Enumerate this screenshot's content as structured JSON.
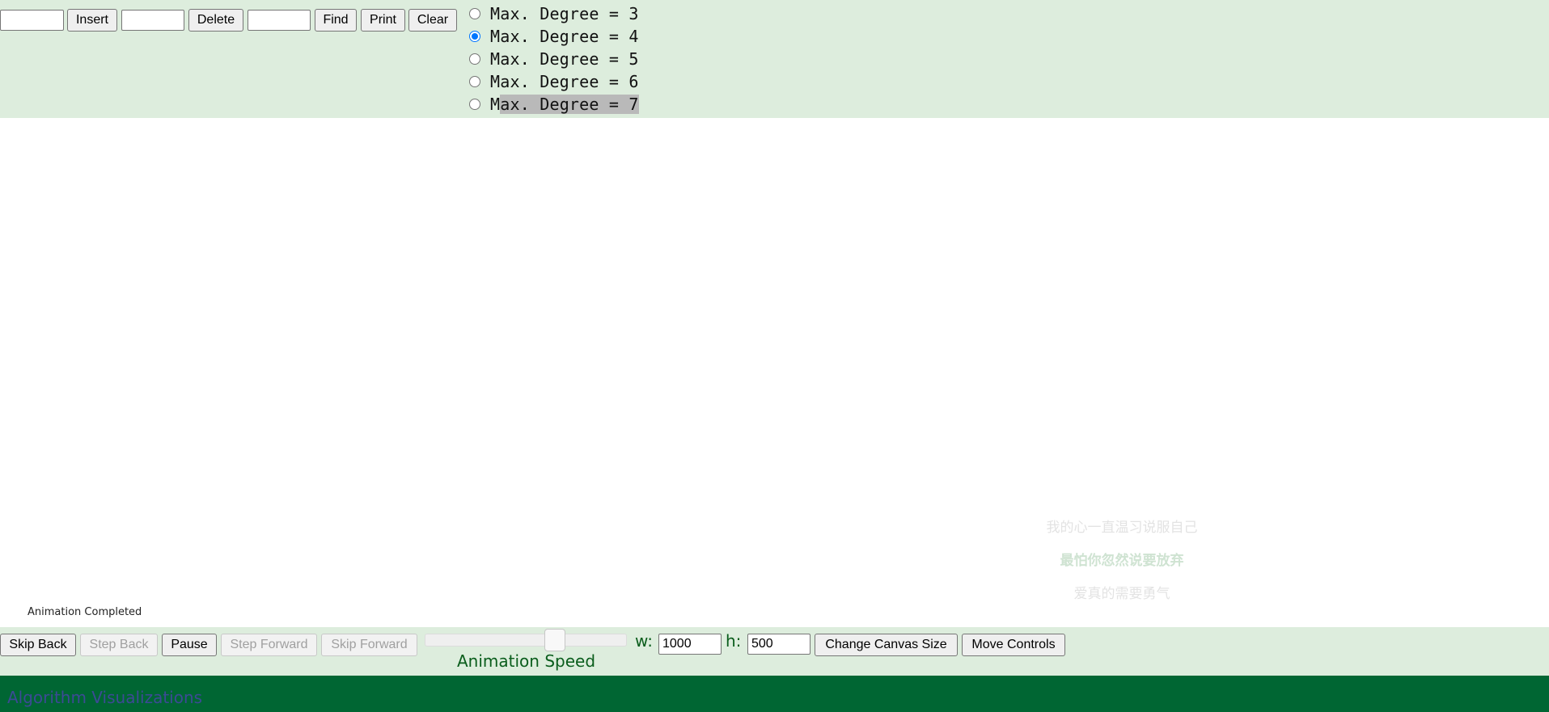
{
  "toolbar": {
    "insert_input_value": "",
    "insert_label": "Insert",
    "delete_input_value": "",
    "delete_label": "Delete",
    "find_input_value": "",
    "find_label": "Find",
    "print_label": "Print",
    "clear_label": "Clear"
  },
  "degree_options": [
    {
      "label": "Max. Degree = 3",
      "checked": false
    },
    {
      "label": "Max. Degree = 4",
      "checked": true
    },
    {
      "label": "Max. Degree = 5",
      "checked": false
    },
    {
      "label": "Max. Degree = 6",
      "checked": false
    },
    {
      "label_prefix": "M",
      "label_highlighted": "ax. Degree = 7",
      "checked": false
    }
  ],
  "canvas": {
    "status_text": "Animation Completed",
    "watermark_lines": [
      "我的心一直温习说服自己",
      "最怕你忽然说要放弃",
      "爱真的需要勇气"
    ]
  },
  "controls": {
    "skip_back": "Skip Back",
    "step_back": "Step Back",
    "pause": "Pause",
    "step_forward": "Step Forward",
    "skip_forward": "Skip Forward",
    "speed_label": "Animation Speed",
    "speed_fraction": 0.6,
    "width_label": "w:",
    "width_value": "1000",
    "height_label": "h:",
    "height_value": "500",
    "change_canvas_size": "Change Canvas Size",
    "move_controls": "Move Controls"
  },
  "footer": {
    "title": "Algorithm Visualizations"
  },
  "colors": {
    "panel_bg": "#ddeddd",
    "footer_bg": "#006633",
    "label_green": "#0a5d1c",
    "radio_accent": "#0075ff"
  }
}
